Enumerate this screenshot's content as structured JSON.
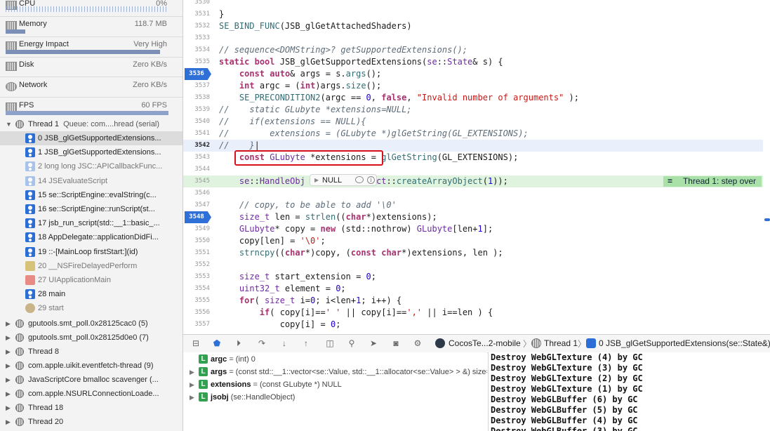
{
  "navigator": {
    "gauges": [
      {
        "name": "CPU",
        "value": "0%",
        "level": 0.0
      },
      {
        "name": "Memory",
        "value": "118.7 MB",
        "level": 0.12
      },
      {
        "name": "Energy Impact",
        "value": "Very High",
        "level": 0.95
      },
      {
        "name": "Disk",
        "value": "Zero KB/s",
        "level": 0.0
      },
      {
        "name": "Network",
        "value": "Zero KB/s",
        "level": 0.0
      },
      {
        "name": "FPS",
        "value": "60 FPS",
        "level": 1.0
      }
    ],
    "thread1": {
      "label": "Thread 1",
      "queue": "Queue: com....hread (serial)"
    },
    "frames": [
      {
        "label": "0 JSB_glGetSupportedExtensions...",
        "kind": "user",
        "selected": true
      },
      {
        "label": "1 JSB_glGetSupportedExtensions...",
        "kind": "user"
      },
      {
        "label": "2 long long JSC::APICallbackFunc...",
        "kind": "sys"
      },
      {
        "label": "14 JSEvaluateScript",
        "kind": "sys"
      },
      {
        "label": "15 se::ScriptEngine::evalString(c...",
        "kind": "user"
      },
      {
        "label": "16 se::ScriptEngine::runScript(st...",
        "kind": "user"
      },
      {
        "label": "17 jsb_run_script(std::__1::basic_...",
        "kind": "user"
      },
      {
        "label": "18 AppDelegate::applicationDidFi...",
        "kind": "user"
      },
      {
        "label": "19 ::-[MainLoop firstStart:](id)",
        "kind": "user"
      },
      {
        "label": "20 __NSFireDelayedPerform",
        "kind": "grid"
      },
      {
        "label": "27 UIApplicationMain",
        "kind": "cal"
      },
      {
        "label": "28 main",
        "kind": "user"
      },
      {
        "label": "29 start",
        "kind": "gear"
      }
    ],
    "threads": [
      "gputools.smt_poll.0x28125cac0 (5)",
      "gputools.smt_poll.0x28125d0e0 (7)",
      "Thread 8",
      "com.apple.uikit.eventfetch-thread (9)",
      "JavaScriptCore bmalloc scavenger (...",
      "com.apple.NSURLConnectionLoade...",
      "Thread 18",
      "Thread 20"
    ]
  },
  "editor": {
    "line_numbers": [
      "3530",
      "3531",
      "3532",
      "3533",
      "3534",
      "3535",
      "3536",
      "3537",
      "3538",
      "3539",
      "3540",
      "3541",
      "3542",
      "3543",
      "3544",
      "3545",
      "3546",
      "3547",
      "3548",
      "3549",
      "3550",
      "3551",
      "3552",
      "3553",
      "3554",
      "3555",
      "3556",
      "3557"
    ],
    "tooltip_value": "NULL",
    "tooltip_info": "i",
    "step_badge": "Thread 1: step over",
    "step_eq": "="
  },
  "debugbar": {
    "scheme": "CocosTe...2-mobile",
    "thread": "Thread 1",
    "frame": "0 JSB_glGetSupportedExtensions(se::State&)"
  },
  "variables": [
    {
      "name": "argc",
      "detail": "= (int) 0",
      "badge": "L",
      "expandable": false
    },
    {
      "name": "args",
      "detail": "= (const std::__1::vector<se::Value, std::__1::allocator<se::Value> > &) size=0",
      "badge": "L",
      "expandable": true
    },
    {
      "name": "extensions",
      "detail": "= (const GLubyte *) NULL",
      "badge": "L",
      "expandable": true
    },
    {
      "name": "jsobj",
      "detail": "(se::HandleObject)",
      "badge": "L",
      "expandable": true
    }
  ],
  "console": [
    "Destroy WebGLTexture (4) by GC",
    "Destroy WebGLTexture (3) by GC",
    "Destroy WebGLTexture (2) by GC",
    "Destroy WebGLTexture (1) by GC",
    "Destroy WebGLBuffer (6) by GC",
    "Destroy WebGLBuffer (5) by GC",
    "Destroy WebGLBuffer (4) by GC",
    "Destroy WebGLBuffer (3) by GC"
  ]
}
